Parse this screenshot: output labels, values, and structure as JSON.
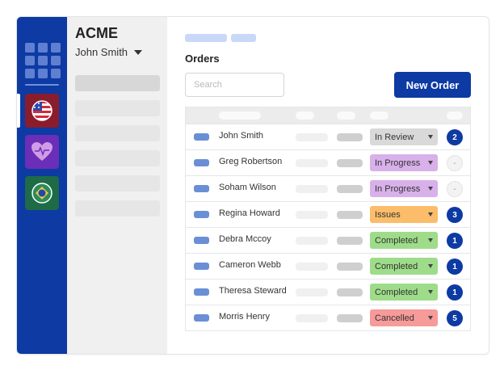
{
  "brand": "ACME",
  "user": {
    "name": "John Smith"
  },
  "rail": {
    "apps": [
      {
        "icon": "us-flag-icon",
        "color": "#8b1c2c"
      },
      {
        "icon": "heart-pulse-icon",
        "color": "#6b2eb8"
      },
      {
        "icon": "brazil-flag-icon",
        "color": "#1e6b47"
      }
    ]
  },
  "page": {
    "title": "Orders",
    "search_placeholder": "Search",
    "new_order_label": "New Order"
  },
  "colors": {
    "primary": "#0d3aa3",
    "in_review": "#d9d9d9",
    "in_progress": "#d8b0ea",
    "issues": "#fbbd6a",
    "completed": "#9edc8a",
    "cancelled": "#f79a9a"
  },
  "orders": [
    {
      "name": "John Smith",
      "status": "In Review",
      "count": "2"
    },
    {
      "name": "Greg Robertson",
      "status": "In Progress",
      "count": "-"
    },
    {
      "name": "Soham Wilson",
      "status": "In Progress",
      "count": "-"
    },
    {
      "name": "Regina Howard",
      "status": "Issues",
      "count": "3"
    },
    {
      "name": "Debra Mccoy",
      "status": "Completed",
      "count": "1"
    },
    {
      "name": "Cameron Webb",
      "status": "Completed",
      "count": "1"
    },
    {
      "name": "Theresa Steward",
      "status": "Completed",
      "count": "1"
    },
    {
      "name": "Morris Henry",
      "status": "Cancelled",
      "count": "5"
    }
  ]
}
